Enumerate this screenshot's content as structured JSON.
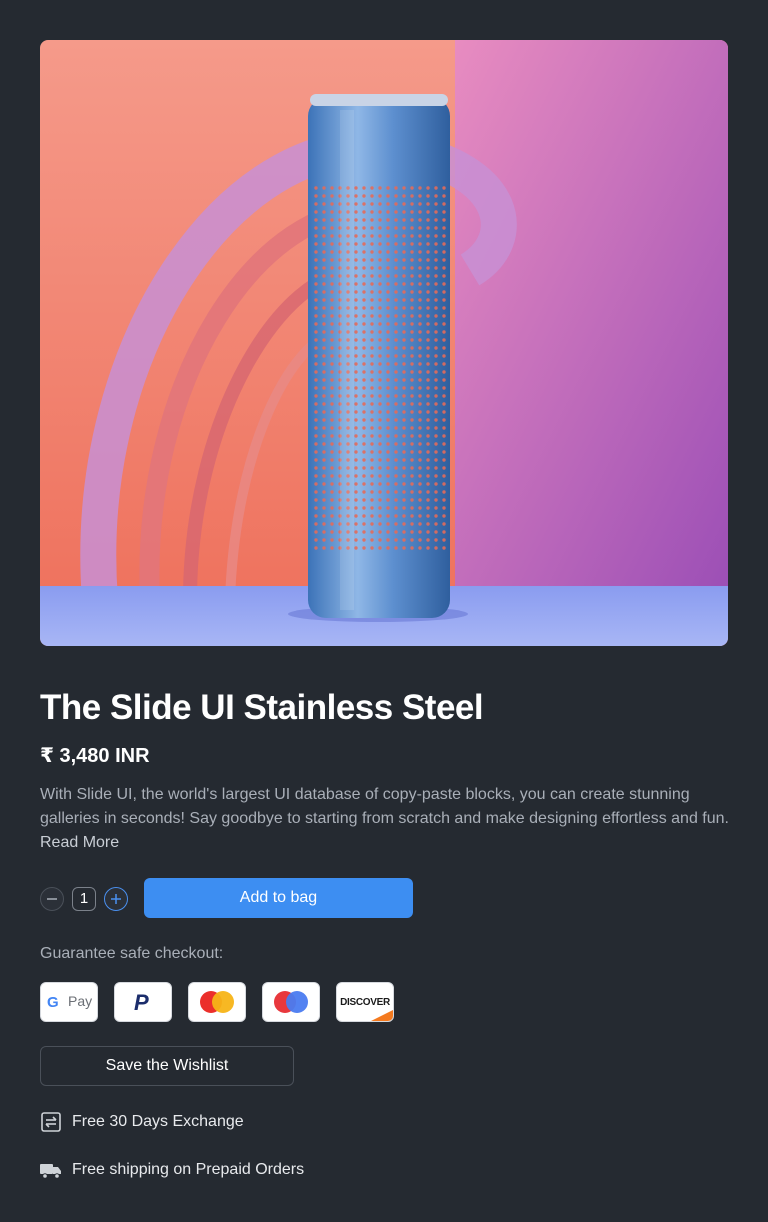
{
  "product": {
    "title": "The Slide UI Stainless Steel",
    "price": "₹ 3,480 INR",
    "description": "With Slide UI, the world's largest UI database of copy-paste blocks, you can create stunning galleries in seconds! Say goodbye to starting from scratch and make designing effortless and fun. ",
    "read_more": "Read More"
  },
  "quantity": {
    "value": "1",
    "decrement_icon": "minus-icon",
    "increment_icon": "plus-icon"
  },
  "actions": {
    "add_to_bag": "Add to bag",
    "save_wishlist": "Save the Wishlist"
  },
  "checkout": {
    "label": "Guarantee safe checkout:",
    "methods": [
      {
        "name": "Google Pay",
        "icon": "google-pay-icon",
        "text": "Pay"
      },
      {
        "name": "PayPal",
        "icon": "paypal-icon"
      },
      {
        "name": "Mastercard",
        "icon": "mastercard-icon"
      },
      {
        "name": "Maestro",
        "icon": "maestro-icon"
      },
      {
        "name": "Discover",
        "icon": "discover-icon",
        "text": "DISCOVER"
      }
    ]
  },
  "features": [
    {
      "icon": "exchange-icon",
      "label": "Free 30 Days Exchange"
    },
    {
      "icon": "truck-icon",
      "label": "Free shipping on Prepaid Orders"
    }
  ],
  "colors": {
    "background": "#252a31",
    "accent": "#3d8ef2",
    "muted_text": "#a9afb8"
  }
}
